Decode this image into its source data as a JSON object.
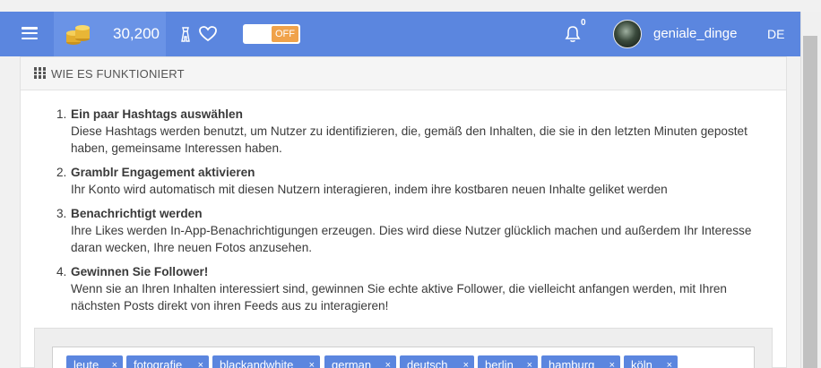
{
  "topbar": {
    "coin_balance": "30,200",
    "toggle_label": "OFF",
    "notification_count": "0",
    "username": "geniale_dinge",
    "language": "DE"
  },
  "card": {
    "title": "WIE ES FUNKTIONIERT",
    "steps": [
      {
        "number": "1.",
        "title": "Ein paar Hashtags auswählen",
        "text": "Diese Hashtags werden benutzt, um Nutzer zu identifizieren, die, gemäß den Inhalten, die sie in den letzten Minuten gepostet haben, gemeinsame Interessen haben."
      },
      {
        "number": "2.",
        "title": "Gramblr Engagement aktivieren",
        "text": "Ihr Konto wird automatisch mit diesen Nutzern interagieren, indem ihre kostbaren neuen Inhalte geliket werden"
      },
      {
        "number": "3.",
        "title": "Benachrichtigt werden",
        "text": "Ihre Likes werden In-App-Benachrichtigungen erzeugen. Dies wird diese Nutzer glücklich machen und außerdem Ihr Interesse daran wecken, Ihre neuen Fotos anzusehen."
      },
      {
        "number": "4.",
        "title": "Gewinnen Sie Follower!",
        "text": "Wenn sie an Ihren Inhalten interessiert sind, gewinnen Sie echte aktive Follower, die vielleicht anfangen werden, mit Ihren nächsten Posts direkt von ihren Feeds aus zu interagieren!"
      }
    ]
  },
  "tags": [
    "leute",
    "fotografie",
    "blackandwhite",
    "german",
    "deutsch",
    "berlin",
    "hamburg",
    "köln"
  ],
  "tag_remove_glyph": "×",
  "colors": {
    "topbar": "#5b86df",
    "toggle_off": "#f0a24a",
    "tag": "#5b86df"
  }
}
